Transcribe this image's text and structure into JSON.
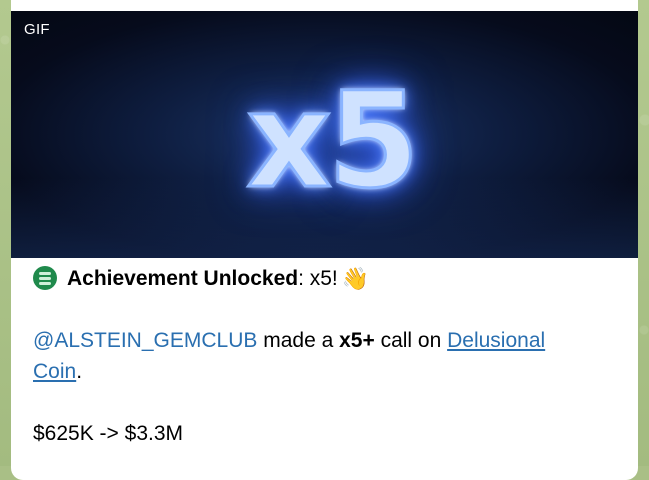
{
  "media": {
    "badge": "GIF",
    "neon_text": "x5"
  },
  "message": {
    "title_bold": "Achievement Unlocked",
    "title_rest": ": x5! ",
    "wave_emoji": "👋",
    "mention": "@ALSTEIN_GEMCLUB",
    "made_a": " made a ",
    "multiplier": "x5+",
    "call_on": " call on ",
    "coin_link_part1": "Delusional ",
    "coin_link_part2": "Coin",
    "period": ".",
    "range": "$625K -> $3.3M"
  },
  "colors": {
    "link": "#2a6fb0",
    "icon_green": "#1f8a4c",
    "chat_bg": "#a9bf86",
    "neon_glow": "#3d6bff"
  },
  "icons": {
    "coin": "solana-coin-icon",
    "wave": "waving-hand-icon"
  }
}
